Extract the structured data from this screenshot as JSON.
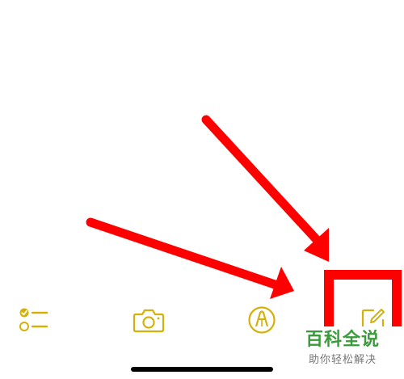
{
  "toolbar": {
    "accent_color": "#D4B10A",
    "buttons": [
      {
        "icon": "checklist-icon"
      },
      {
        "icon": "camera-icon"
      },
      {
        "icon": "markup-pen-icon"
      },
      {
        "icon": "compose-new-note-icon"
      }
    ]
  },
  "annotations": {
    "arrow_color": "#FF0000",
    "highlight_color": "#FF0000",
    "highlighted_button": "compose-new-note-icon"
  },
  "watermark": {
    "title": "百科全说",
    "subtitle": "助你轻松解决",
    "title_color": "#3A9B3A"
  }
}
